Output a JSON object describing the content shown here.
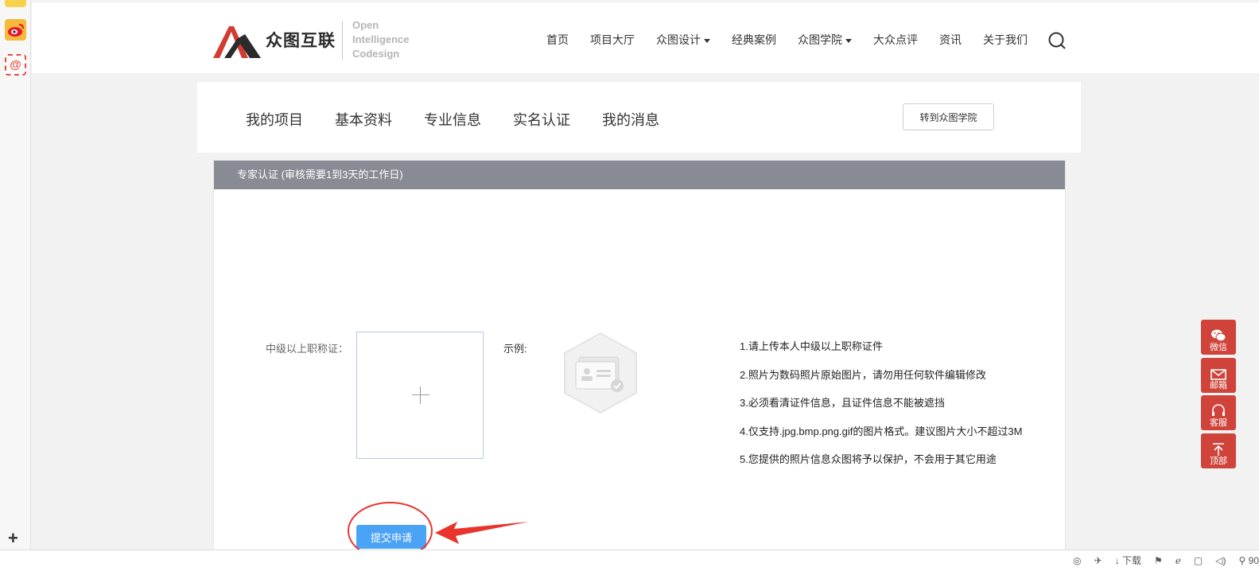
{
  "colors": {
    "accent_red": "#d0433a",
    "submit_blue": "#4aa3f5",
    "panel_header": "#888b94",
    "annotation_red": "#e8342c"
  },
  "left_sidebar": {
    "icons": [
      "bookmark-icon",
      "weibo-icon",
      "mail-icon"
    ],
    "mail_glyph": "@",
    "add_glyph": "+"
  },
  "header": {
    "logo_name": "众图互联",
    "logo_en": [
      "Open",
      "Intelligence",
      "Codesign"
    ],
    "nav": [
      {
        "label": "首页",
        "dropdown": false
      },
      {
        "label": "项目大厅",
        "dropdown": false
      },
      {
        "label": "众图设计",
        "dropdown": true
      },
      {
        "label": "经典案例",
        "dropdown": false
      },
      {
        "label": "众图学院",
        "dropdown": true
      },
      {
        "label": "大众点评",
        "dropdown": false
      },
      {
        "label": "资讯",
        "dropdown": false
      },
      {
        "label": "关于我们",
        "dropdown": false
      }
    ]
  },
  "subnav": {
    "tabs": [
      "我的项目",
      "基本资料",
      "专业信息",
      "实名认证",
      "我的消息"
    ],
    "goto_label": "转到众图学院"
  },
  "panel": {
    "title": "专家认证 (审核需要1到3天的工作日)",
    "field_label": "中级以上职称证：",
    "example_label": "示例:",
    "tips": [
      "1.请上传本人中级以上职称证件",
      "2.照片为数码照片原始图片，请勿用任何软件编辑修改",
      "3.必须看清证件信息，且证件信息不能被遮挡",
      "4.仅支持.jpg.bmp.png.gif的图片格式。建议图片大小不超过3M",
      "5.您提供的照片信息众图将予以保护，不会用于其它用途"
    ],
    "submit_label": "提交申请"
  },
  "float_bar": [
    {
      "icon": "wechat-icon",
      "label": "微信"
    },
    {
      "icon": "envelope-icon",
      "label": "邮箱"
    },
    {
      "icon": "headset-icon",
      "label": "客服"
    },
    {
      "icon": "arrow-up-icon",
      "label": "顶部"
    }
  ],
  "statusbar": {
    "download_label": "下载",
    "zoom_label": "90"
  }
}
